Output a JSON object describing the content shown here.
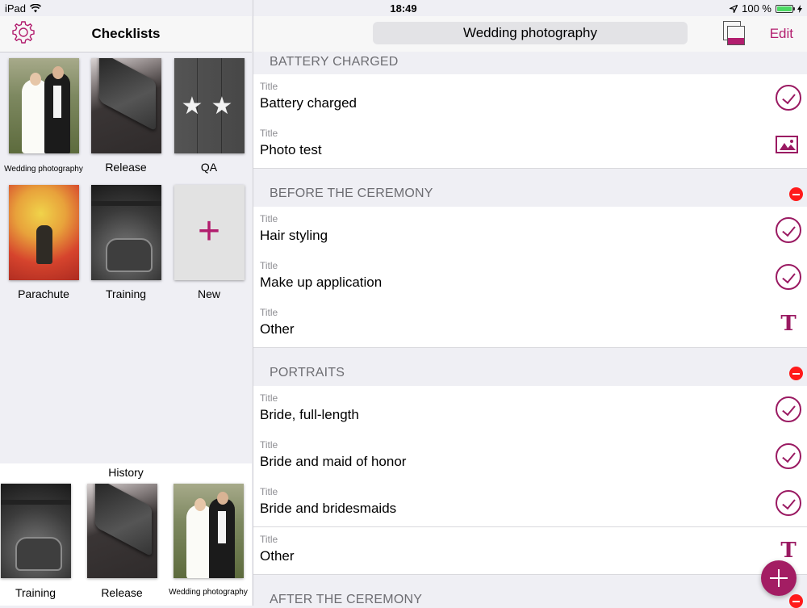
{
  "status_bar": {
    "device": "iPad",
    "time": "18:49",
    "battery": "100 %",
    "battery_level": 1.0
  },
  "sidebar": {
    "title": "Checklists",
    "items": [
      {
        "label": "Wedding photography"
      },
      {
        "label": "Release"
      },
      {
        "label": "QA"
      },
      {
        "label": "Parachute"
      },
      {
        "label": "Training"
      },
      {
        "label": "New"
      }
    ],
    "history": {
      "title": "History",
      "items": [
        {
          "label": "Training"
        },
        {
          "label": "Release"
        },
        {
          "label": "Wedding photography"
        }
      ]
    }
  },
  "detail": {
    "checklist_title": "Wedding photography",
    "edit_label": "Edit",
    "sections": [
      {
        "title": "BATTERY CHARGED",
        "rows": [
          {
            "label": "Title",
            "value": "Battery charged",
            "icon": "check-circle-icon"
          },
          {
            "label": "Title",
            "value": "Photo test",
            "icon": "image-icon"
          }
        ]
      },
      {
        "title": "BEFORE THE CEREMONY",
        "rows": [
          {
            "label": "Title",
            "value": "Hair styling",
            "icon": "check-circle-icon"
          },
          {
            "label": "Title",
            "value": "Make up application",
            "icon": "check-circle-icon"
          },
          {
            "label": "Title",
            "value": "Other",
            "icon": "text-icon"
          }
        ]
      },
      {
        "title": "PORTRAITS",
        "rows": [
          {
            "label": "Title",
            "value": "Bride, full-length",
            "icon": "check-circle-icon"
          },
          {
            "label": "Title",
            "value": "Bride and maid of honor",
            "icon": "check-circle-icon"
          },
          {
            "label": "Title",
            "value": "Bride and bridesmaids",
            "icon": "check-circle-icon"
          },
          {
            "label": "Title",
            "value": "Other",
            "icon": "text-icon"
          }
        ]
      },
      {
        "title": "AFTER THE CEREMONY",
        "rows": []
      }
    ],
    "text_icon_glyph": "T"
  },
  "colors": {
    "accent": "#b21d6e",
    "delete": "#ff1a1a",
    "background": "#efeff4"
  }
}
